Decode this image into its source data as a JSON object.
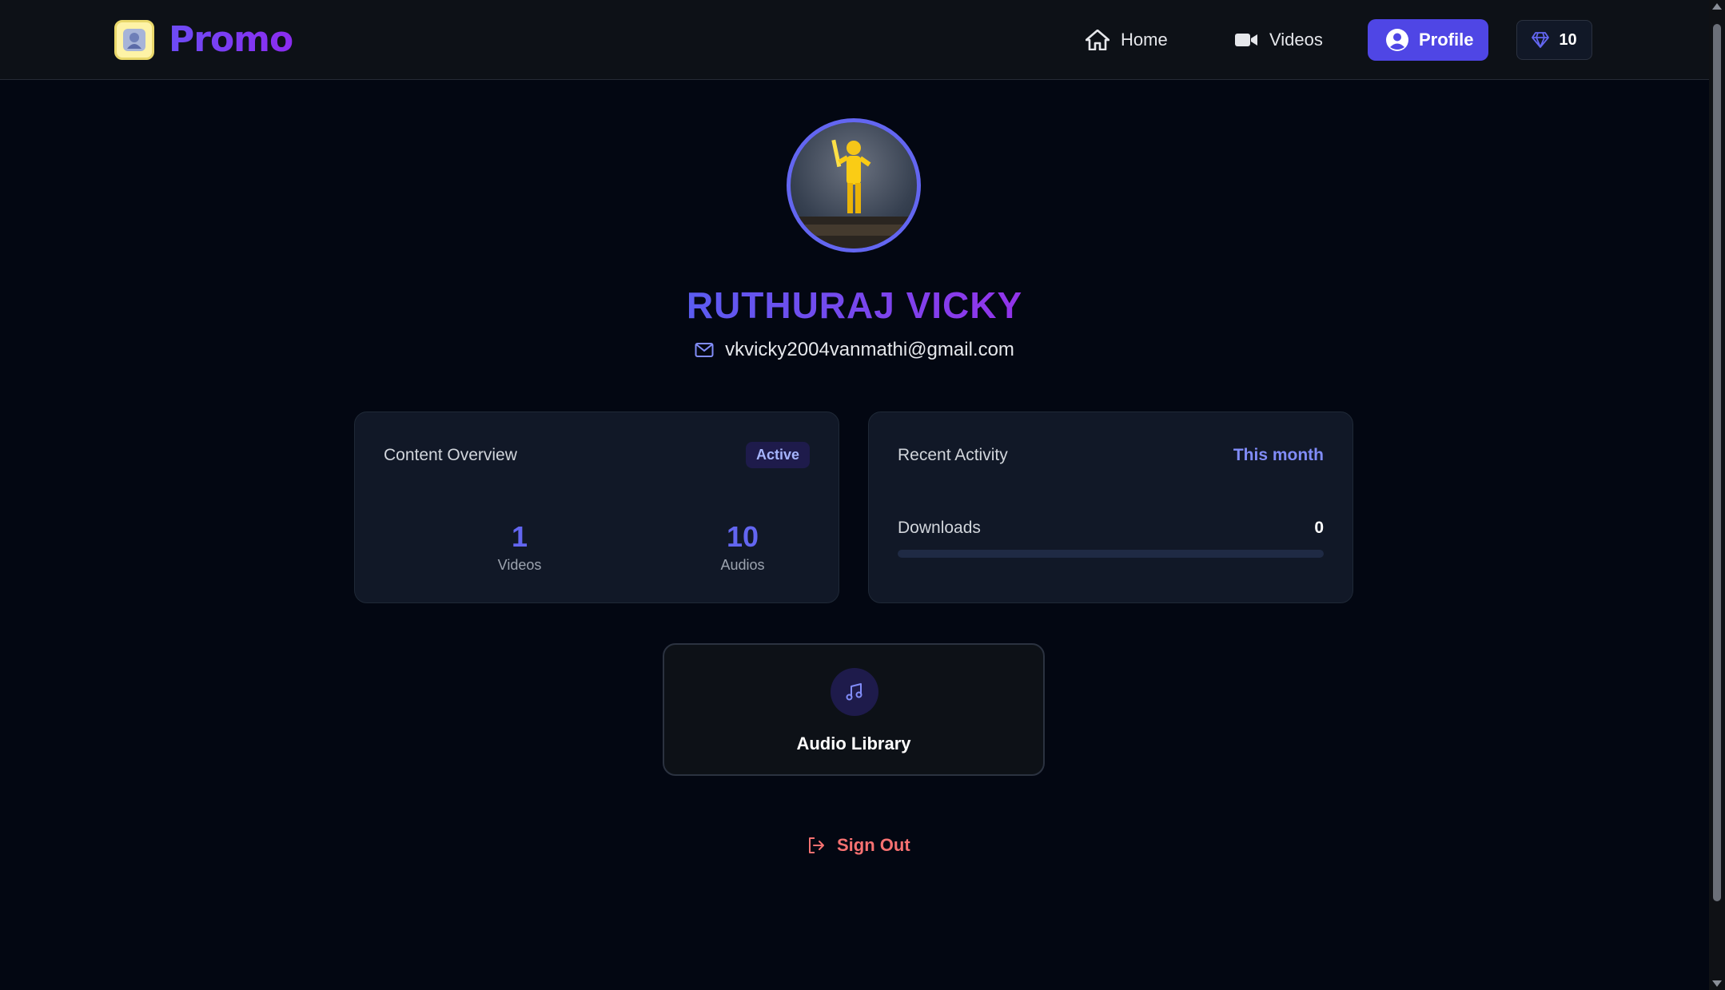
{
  "app": {
    "brand_name": "Promo"
  },
  "nav": {
    "items": [
      {
        "label": "Home",
        "icon": "home-icon"
      },
      {
        "label": "Videos",
        "icon": "video-camera-icon"
      },
      {
        "label": "Profile",
        "icon": "user-circle-icon",
        "active": true
      }
    ],
    "credits": {
      "value": "10",
      "icon": "diamond-icon"
    }
  },
  "profile": {
    "name": "RUTHURAJ VICKY",
    "email": "vkvicky2004vanmathi@gmail.com"
  },
  "content_overview": {
    "title": "Content Overview",
    "badge": "Active",
    "stats": [
      {
        "value": "1",
        "label": "Videos"
      },
      {
        "value": "10",
        "label": "Audios"
      }
    ]
  },
  "recent_activity": {
    "title": "Recent Activity",
    "period": "This month",
    "downloads_label": "Downloads",
    "downloads_value": "0",
    "downloads_progress": 0
  },
  "audio_library": {
    "label": "Audio Library",
    "icon": "music-note-icon"
  },
  "sign_out": {
    "label": "Sign Out",
    "icon": "logout-icon"
  },
  "colors": {
    "accent": "#4f46e5",
    "danger": "#f87171",
    "background": "#030712",
    "card": "#111827"
  }
}
